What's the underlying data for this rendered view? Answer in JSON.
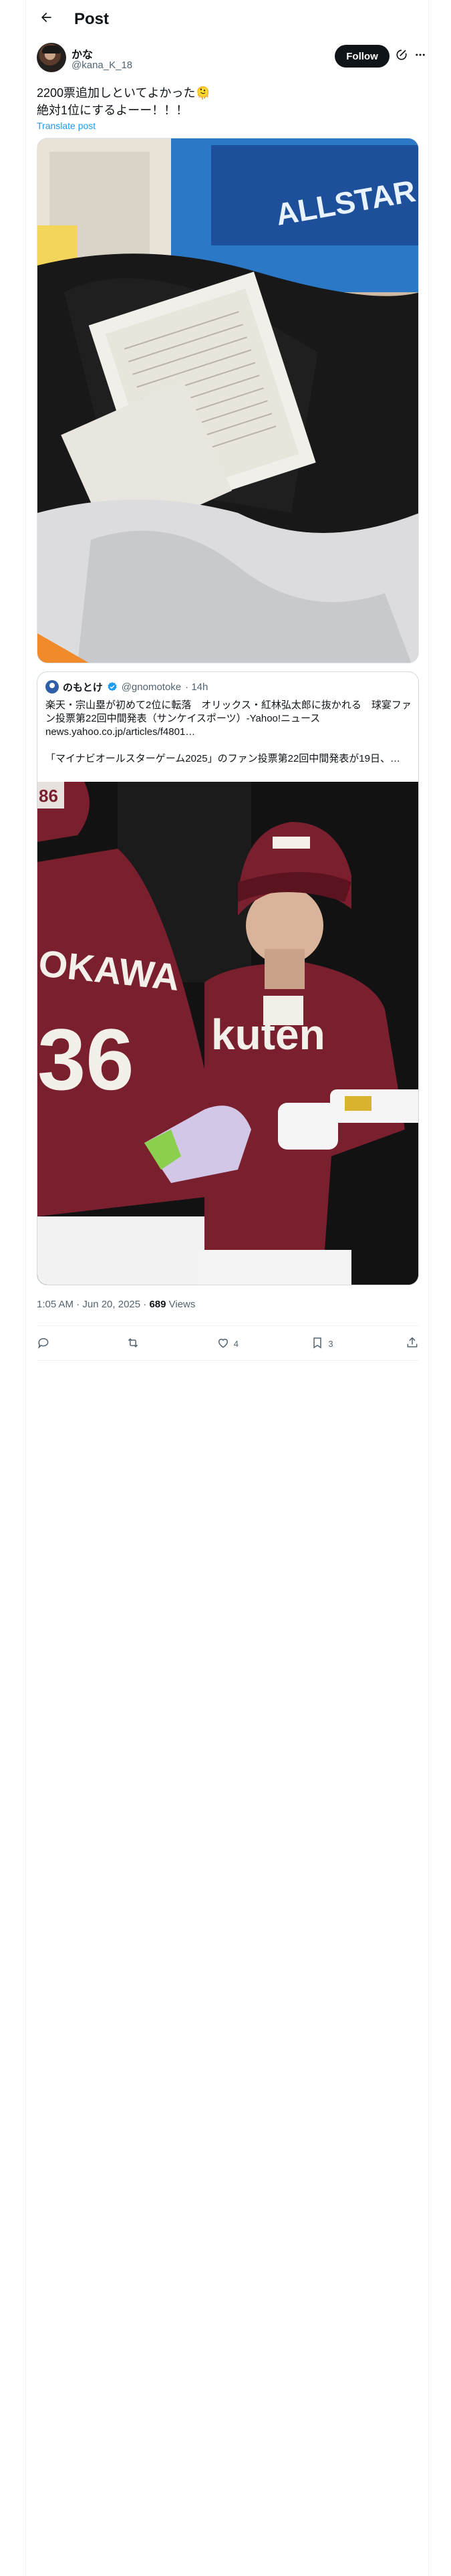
{
  "header": {
    "title": "Post",
    "back_icon": "arrow-left-icon"
  },
  "author": {
    "display_name": "かな",
    "handle": "@kana_K_18",
    "follow_label": "Follow",
    "grok_icon": "grok-icon",
    "more_icon": "more-icon"
  },
  "post": {
    "text": "2200票追加しといてよかった🫠\n絶対1位にするよーー！！！",
    "translate_label": "Translate post"
  },
  "quote": {
    "display_name": "のもとけ",
    "handle": "@gnomotoke",
    "time": "· 14h",
    "text": "楽天・宗山塁が初めて2位に転落　オリックス・紅林弘太郎に抜かれる　球宴ファン投票第22回中間発表（サンケイスポーツ）-Yahoo!ニュース\nnews.yahoo.co.jp/articles/f4801…\n\n「マイナビオールスターゲーム2025」のファン投票第22回中間発表が19日、…"
  },
  "footer": {
    "time": "1:05 AM · Jun 20, 2025",
    "dot": " · ",
    "views": "689",
    "views_label": " Views"
  },
  "actions": {
    "reply_count": "",
    "repost_count": "",
    "like_count": "4",
    "bookmark_count": "3"
  },
  "colors": {
    "accent": "#1d9bf0",
    "text": "#0f1419",
    "muted": "#536471",
    "border": "#eff3f4",
    "eagles_crimson": "#7a1f2d"
  }
}
